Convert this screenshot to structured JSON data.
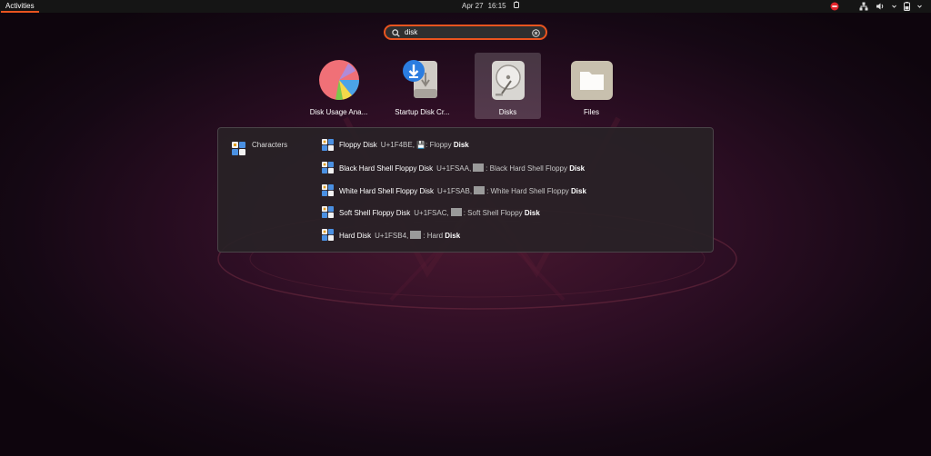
{
  "topbar": {
    "activities": "Activities",
    "date": "Apr 27",
    "time": "16:15",
    "icons": [
      "alarm-icon",
      "do-not-disturb-icon",
      "network-icon",
      "volume-icon",
      "battery-icon"
    ]
  },
  "search": {
    "value": "disk",
    "icons": [
      "search-icon",
      "clear-icon"
    ]
  },
  "apps": [
    {
      "label": "Disk Usage Ana...",
      "icon": "disk-usage-analyzer-icon"
    },
    {
      "label": "Startup Disk Cr...",
      "icon": "startup-disk-creator-icon"
    },
    {
      "label": "Disks",
      "icon": "disks-icon",
      "selected": true
    },
    {
      "label": "Files",
      "icon": "files-icon"
    }
  ],
  "provider": {
    "name": "Characters",
    "results": [
      {
        "title": "Floppy Disk",
        "code": "U+1F4BE,",
        "glyph": "💾",
        "name_prefix": ": Floppy ",
        "name_match": "Disk"
      },
      {
        "title": "Black Hard Shell Floppy Disk",
        "code": "U+1FSAA,",
        "name_prefix": ": Black Hard Shell Floppy ",
        "name_match": "Disk"
      },
      {
        "title": "White Hard Shell Floppy Disk",
        "code": "U+1FSAB,",
        "name_prefix": ": White Hard Shell Floppy ",
        "name_match": "Disk"
      },
      {
        "title": "Soft Shell Floppy Disk",
        "code": "U+1FSAC,",
        "name_prefix": ": Soft Shell Floppy ",
        "name_match": "Disk"
      },
      {
        "title": "Hard Disk",
        "code": "U+1FSB4,",
        "name_prefix": ": Hard ",
        "name_match": "Disk"
      }
    ]
  },
  "colors": {
    "accent": "#e9541f",
    "topbar": "#151515",
    "panel": "#282226"
  }
}
